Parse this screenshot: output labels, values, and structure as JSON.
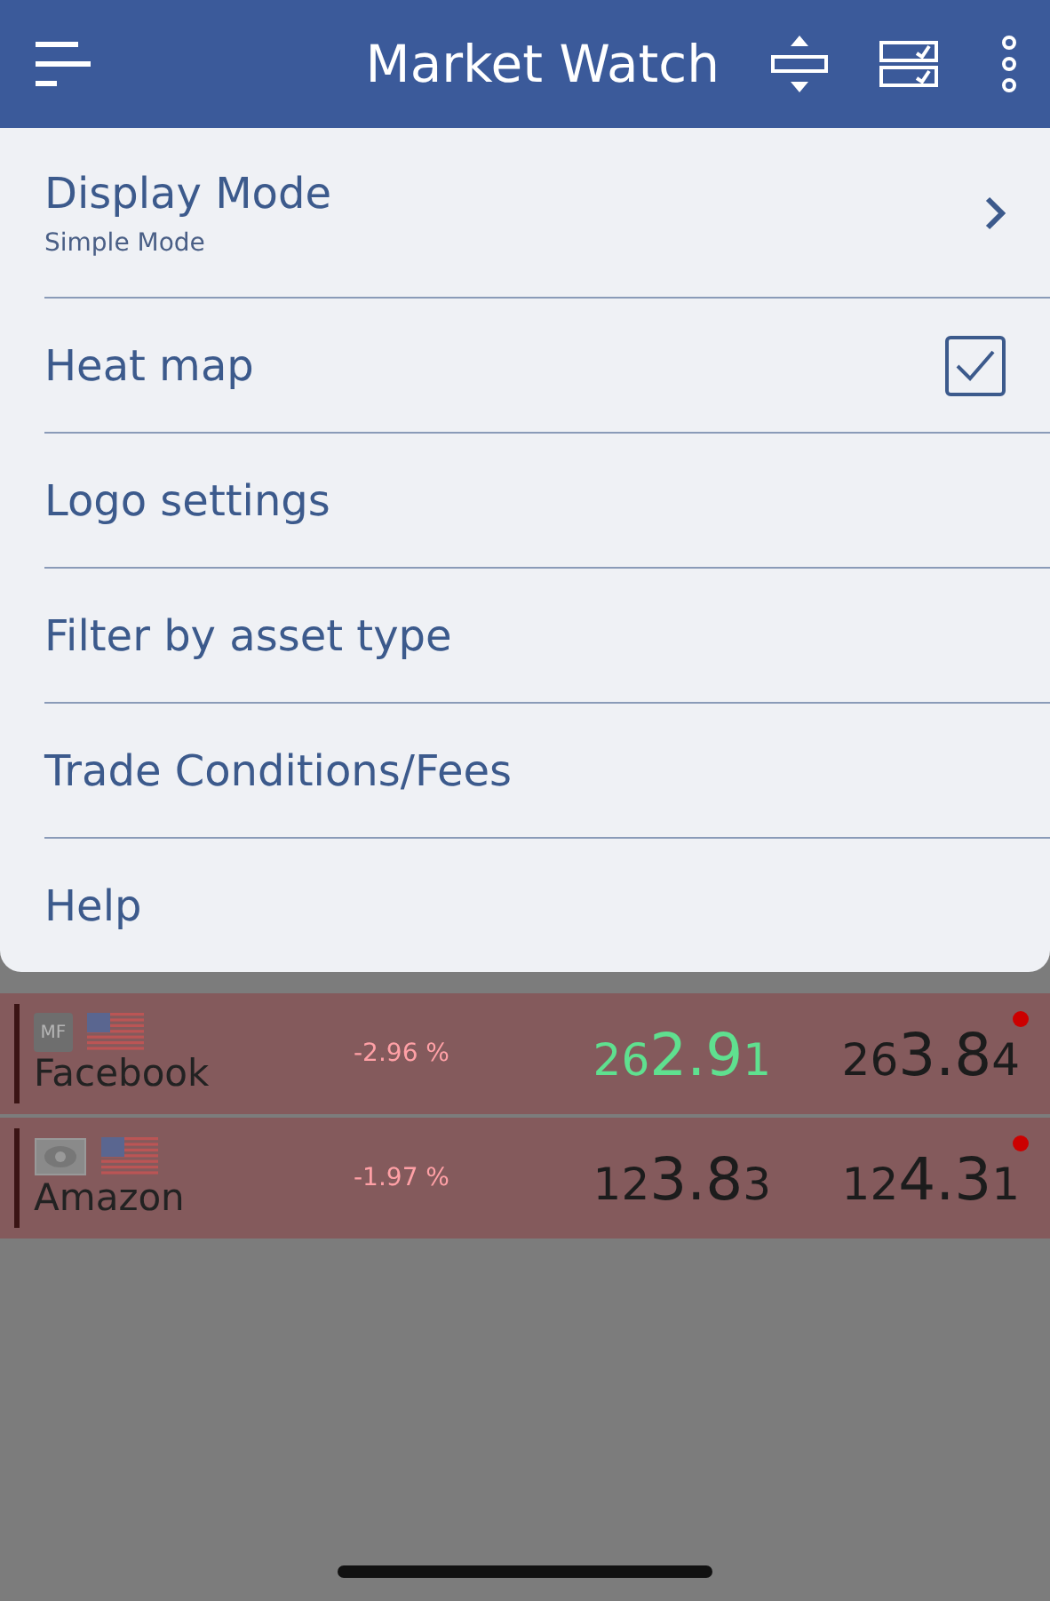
{
  "header": {
    "title": "Market Watch"
  },
  "menu": [
    {
      "kind": "submenu",
      "label": "Display Mode",
      "subtitle": "Simple Mode"
    },
    {
      "kind": "checkbox",
      "label": "Heat map",
      "checked": true
    },
    {
      "kind": "plain",
      "label": "Logo settings"
    },
    {
      "kind": "plain",
      "label": "Filter by asset type"
    },
    {
      "kind": "plain",
      "label": "Trade Conditions/Fees"
    },
    {
      "kind": "plain",
      "label": "Help"
    }
  ],
  "quotes": [
    {
      "name": "Facebook",
      "logo": {
        "kind": "badge",
        "text": "MF"
      },
      "change": "-2.96 %",
      "bid": {
        "prefix": "26",
        "main": "2.9",
        "suffix": "1",
        "rising": true
      },
      "ask": {
        "prefix": "26",
        "main": "3.8",
        "suffix": "4",
        "rising": false
      }
    },
    {
      "name": "Amazon",
      "logo": {
        "kind": "banknote"
      },
      "change": "-1.97 %",
      "bid": {
        "prefix": "12",
        "main": "3.8",
        "suffix": "3",
        "rising": false
      },
      "ask": {
        "prefix": "12",
        "main": "4.3",
        "suffix": "1",
        "rising": false
      }
    }
  ]
}
